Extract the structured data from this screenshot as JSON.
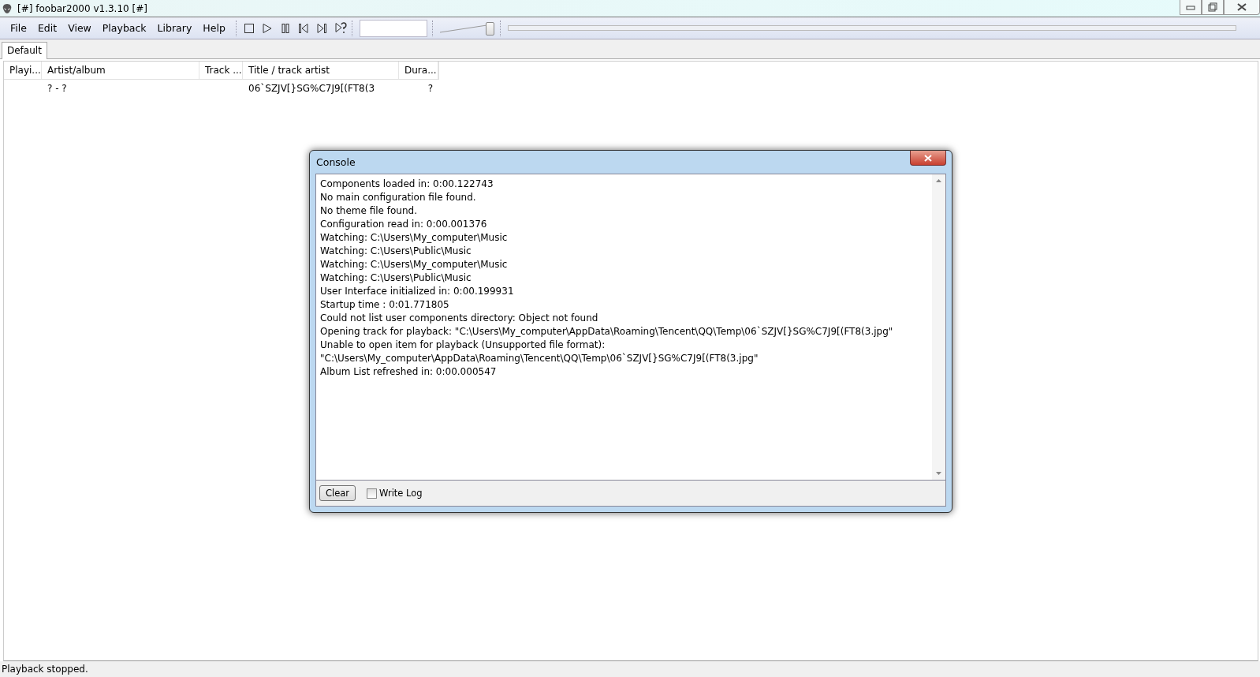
{
  "window": {
    "title": "[#] foobar2000 v1.3.10 [#]"
  },
  "menu": [
    "File",
    "Edit",
    "View",
    "Playback",
    "Library",
    "Help"
  ],
  "volume": {
    "level": 0.95
  },
  "tabs": [
    {
      "label": "Default",
      "selected": true
    }
  ],
  "playlist": {
    "columns": [
      "Playi...",
      "Artist/album",
      "Track ...",
      "Title / track artist",
      "Dura..."
    ],
    "rows": [
      {
        "cells": [
          "",
          "? - ?",
          "",
          "06`SZJV[}SG%C7J9[(FT8(3",
          "?"
        ]
      }
    ]
  },
  "console": {
    "title": "Console",
    "lines": [
      "Components loaded in: 0:00.122743",
      "No main configuration file found.",
      "No theme file found.",
      "Configuration read in: 0:00.001376",
      "Watching: C:\\Users\\My_computer\\Music",
      "Watching: C:\\Users\\Public\\Music",
      "Watching: C:\\Users\\My_computer\\Music",
      "Watching: C:\\Users\\Public\\Music",
      "User Interface initialized in: 0:00.199931",
      "Startup time : 0:01.771805",
      "Could not list user components directory: Object not found",
      "Opening track for playback: \"C:\\Users\\My_computer\\AppData\\Roaming\\Tencent\\QQ\\Temp\\06`SZJV[}SG%C7J9[(FT8(3.jpg\"",
      "Unable to open item for playback (Unsupported file format):",
      "\"C:\\Users\\My_computer\\AppData\\Roaming\\Tencent\\QQ\\Temp\\06`SZJV[}SG%C7J9[(FT8(3.jpg\"",
      "Album List refreshed in: 0:00.000547"
    ],
    "clear_button": "Clear",
    "write_log": {
      "label": "Write Log",
      "checked": false
    }
  },
  "status_bar": "Playback stopped."
}
